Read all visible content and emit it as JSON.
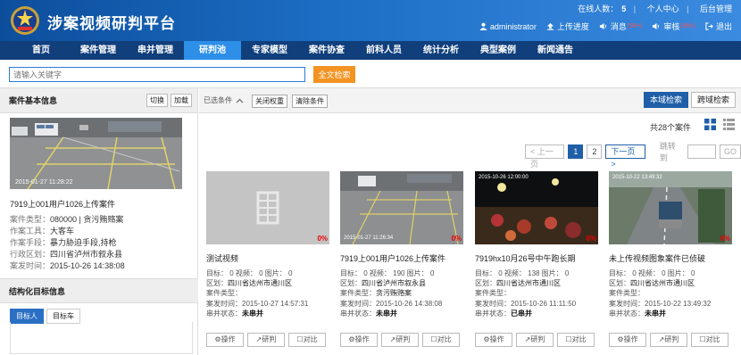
{
  "app": {
    "title": "涉案视频研判平台"
  },
  "topbar": {
    "online_label": "在线人数：",
    "online_count": "5",
    "personal_center": "个人中心",
    "admin_panel": "后台管理"
  },
  "actions": {
    "user": "administrator",
    "upload": "上传进度",
    "message": "消息",
    "message_badge": "(99+)",
    "review": "审核",
    "review_badge": "(99+)",
    "logout": "退出"
  },
  "nav": [
    "首页",
    "案件管理",
    "串并管理",
    "研判池",
    "专家模型",
    "案件协查",
    "前科人员",
    "统计分析",
    "典型案例",
    "新闻通告"
  ],
  "nav_active": "研判池",
  "search": {
    "placeholder": "请输入关键字",
    "button": "全文检索"
  },
  "left_panel": {
    "header": "案件基本信息",
    "switch_btn": "切换",
    "load_btn": "加载",
    "case_title": "7919上001用户1026上传案件",
    "info": [
      {
        "k": "案件类型：",
        "v": "080000 | 贪污贿赂案"
      },
      {
        "k": "作案工具：",
        "v": "大客车"
      },
      {
        "k": "作案手段：",
        "v": "暴力胁迫手段,持枪"
      },
      {
        "k": "行政区划：",
        "v": "四川省泸州市叙永县"
      },
      {
        "k": "案发时间：",
        "v": "2015-10-26 14:38:08"
      }
    ],
    "header2": "结构化目标信息",
    "tabs": [
      "目标人",
      "目标车"
    ]
  },
  "filter": {
    "selected_label": "已选条件",
    "close_weight": "关闭权重",
    "clear": "清除条件",
    "local_search": "本域检索",
    "cross_search": "跨域检索"
  },
  "results": {
    "count_text": "共28个案件"
  },
  "pager": {
    "prev": "< 上一页",
    "pages": [
      "1",
      "2"
    ],
    "next": "下一页 >",
    "jump": "跳转到",
    "go": "GO"
  },
  "cards": [
    {
      "title": "测试视频",
      "counts": "目标： 0  视频： 0  图片： 0",
      "region": "四川省达州市通川区",
      "type": "",
      "time": "2015-10-27 14:57:31",
      "status": "未串并",
      "pct": "0%"
    },
    {
      "title": "7919上001用户1026上传案件",
      "counts": "目标： 0  视频： 190  图片： 0",
      "region": "四川省泸州市叙永县",
      "type": "贪污贿赂案",
      "time": "2015-10-26 14:38:08",
      "status": "未串并",
      "pct": "0%"
    },
    {
      "title": "7919hx10月26号中午跑长期",
      "counts": "目标： 0  视频： 138  图片： 0",
      "region": "四川省达州市通川区",
      "type": "",
      "time": "2015-10-26 11:11:50",
      "status": "已串并",
      "pct": "0%"
    },
    {
      "title": "未上传视频图象案件已侦破",
      "counts": "目标： 0  视频： 0  图片： 0",
      "region": "四川省达州市通川区",
      "type": "",
      "time": "2015-10-22 13:49:32",
      "status": "未串并",
      "pct": "0%"
    }
  ],
  "card_labels": {
    "region": "区划：",
    "type": "案件类型：",
    "time": "案发时间：",
    "status": "串并状态：",
    "op": "操作",
    "judge": "研判",
    "compare": "对比"
  }
}
